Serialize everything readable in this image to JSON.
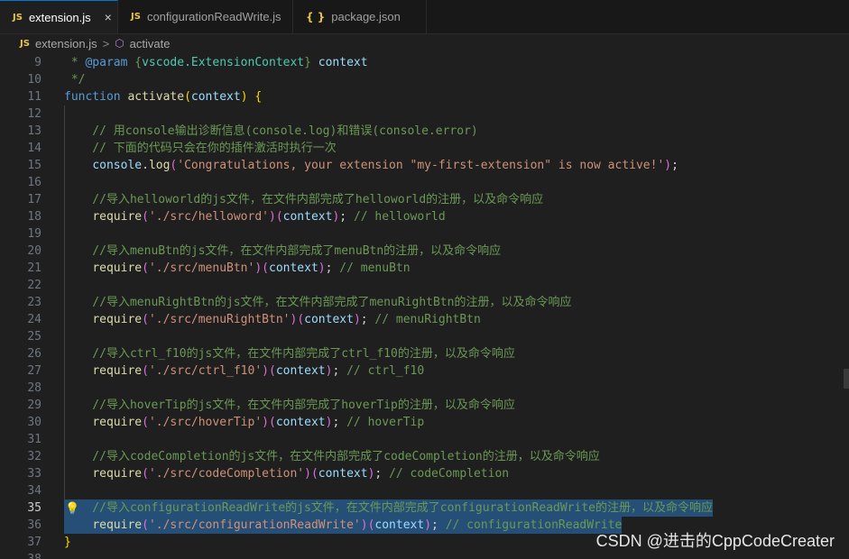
{
  "tabs": [
    {
      "icon": "JS",
      "label": "extension.js",
      "close": "×",
      "active": true
    },
    {
      "icon": "JS",
      "label": "configurationReadWrite.js",
      "active": false
    },
    {
      "icon": "{ }",
      "label": "package.json",
      "active": false
    }
  ],
  "breadcrumb": {
    "icon": "JS",
    "file": "extension.js",
    "separator": ">",
    "symbol_icon": "cube-icon",
    "symbol": "activate"
  },
  "lines": [
    {
      "n": "9",
      "parts": [
        [
          " * ",
          "c"
        ],
        [
          "@param",
          "dc"
        ],
        [
          " {",
          "c"
        ],
        [
          "vscode.ExtensionContext",
          "t"
        ],
        [
          "} ",
          "c"
        ],
        [
          "context",
          "p"
        ]
      ]
    },
    {
      "n": "10",
      "parts": [
        [
          " */",
          "c"
        ]
      ]
    },
    {
      "n": "11",
      "parts": [
        [
          "function",
          "k"
        ],
        [
          " ",
          "pl"
        ],
        [
          "activate",
          "f"
        ],
        [
          "(",
          "b1"
        ],
        [
          "context",
          "p"
        ],
        [
          ") ",
          "b1"
        ],
        [
          "{",
          "b1"
        ]
      ]
    },
    {
      "n": "12",
      "parts": []
    },
    {
      "n": "13",
      "parts": [
        [
          "    // 用console输出诊断信息(console.log)和错误(console.error)",
          "c"
        ]
      ]
    },
    {
      "n": "14",
      "parts": [
        [
          "    // 下面的代码只会在你的插件激活时执行一次",
          "c"
        ]
      ]
    },
    {
      "n": "15",
      "parts": [
        [
          "    ",
          "pl"
        ],
        [
          "console",
          "p"
        ],
        [
          ".",
          "pl"
        ],
        [
          "log",
          "f"
        ],
        [
          "(",
          "b2"
        ],
        [
          "'Congratulations, your extension \"my-first-extension\" is now active!'",
          "s"
        ],
        [
          ")",
          "b2"
        ],
        [
          ";",
          "pl"
        ]
      ]
    },
    {
      "n": "16",
      "parts": []
    },
    {
      "n": "17",
      "parts": [
        [
          "    //导入helloworld的js文件，在文件内部完成了helloworld的注册，以及命令响应",
          "c"
        ]
      ]
    },
    {
      "n": "18",
      "parts": [
        [
          "    ",
          "pl"
        ],
        [
          "require",
          "f"
        ],
        [
          "(",
          "b2"
        ],
        [
          "'./src/helloword'",
          "s"
        ],
        [
          ")",
          "b2"
        ],
        [
          "(",
          "b2"
        ],
        [
          "context",
          "p"
        ],
        [
          ")",
          "b2"
        ],
        [
          "; ",
          "pl"
        ],
        [
          "// helloworld",
          "c"
        ]
      ]
    },
    {
      "n": "19",
      "parts": []
    },
    {
      "n": "20",
      "parts": [
        [
          "    //导入menuBtn的js文件，在文件内部完成了menuBtn的注册，以及命令响应",
          "c"
        ]
      ]
    },
    {
      "n": "21",
      "parts": [
        [
          "    ",
          "pl"
        ],
        [
          "require",
          "f"
        ],
        [
          "(",
          "b2"
        ],
        [
          "'./src/menuBtn'",
          "s"
        ],
        [
          ")",
          "b2"
        ],
        [
          "(",
          "b2"
        ],
        [
          "context",
          "p"
        ],
        [
          ")",
          "b2"
        ],
        [
          "; ",
          "pl"
        ],
        [
          "// menuBtn",
          "c"
        ]
      ]
    },
    {
      "n": "22",
      "parts": []
    },
    {
      "n": "23",
      "parts": [
        [
          "    //导入menuRightBtn的js文件，在文件内部完成了menuRightBtn的注册，以及命令响应",
          "c"
        ]
      ]
    },
    {
      "n": "24",
      "parts": [
        [
          "    ",
          "pl"
        ],
        [
          "require",
          "f"
        ],
        [
          "(",
          "b2"
        ],
        [
          "'./src/menuRightBtn'",
          "s"
        ],
        [
          ")",
          "b2"
        ],
        [
          "(",
          "b2"
        ],
        [
          "context",
          "p"
        ],
        [
          ")",
          "b2"
        ],
        [
          "; ",
          "pl"
        ],
        [
          "// menuRightBtn",
          "c"
        ]
      ]
    },
    {
      "n": "25",
      "parts": []
    },
    {
      "n": "26",
      "parts": [
        [
          "    //导入ctrl_f10的js文件，在文件内部完成了ctrl_f10的注册，以及命令响应",
          "c"
        ]
      ]
    },
    {
      "n": "27",
      "parts": [
        [
          "    ",
          "pl"
        ],
        [
          "require",
          "f"
        ],
        [
          "(",
          "b2"
        ],
        [
          "'./src/ctrl_f10'",
          "s"
        ],
        [
          ")",
          "b2"
        ],
        [
          "(",
          "b2"
        ],
        [
          "context",
          "p"
        ],
        [
          ")",
          "b2"
        ],
        [
          "; ",
          "pl"
        ],
        [
          "// ctrl_f10",
          "c"
        ]
      ]
    },
    {
      "n": "28",
      "parts": []
    },
    {
      "n": "29",
      "parts": [
        [
          "    //导入hoverTip的js文件，在文件内部完成了hoverTip的注册，以及命令响应",
          "c"
        ]
      ]
    },
    {
      "n": "30",
      "parts": [
        [
          "    ",
          "pl"
        ],
        [
          "require",
          "f"
        ],
        [
          "(",
          "b2"
        ],
        [
          "'./src/hoverTip'",
          "s"
        ],
        [
          ")",
          "b2"
        ],
        [
          "(",
          "b2"
        ],
        [
          "context",
          "p"
        ],
        [
          ")",
          "b2"
        ],
        [
          "; ",
          "pl"
        ],
        [
          "// hoverTip",
          "c"
        ]
      ]
    },
    {
      "n": "31",
      "parts": []
    },
    {
      "n": "32",
      "parts": [
        [
          "    //导入codeCompletion的js文件，在文件内部完成了codeCompletion的注册，以及命令响应",
          "c"
        ]
      ]
    },
    {
      "n": "33",
      "parts": [
        [
          "    ",
          "pl"
        ],
        [
          "require",
          "f"
        ],
        [
          "(",
          "b2"
        ],
        [
          "'./src/codeCompletion'",
          "s"
        ],
        [
          ")",
          "b2"
        ],
        [
          "(",
          "b2"
        ],
        [
          "context",
          "p"
        ],
        [
          ")",
          "b2"
        ],
        [
          "; ",
          "pl"
        ],
        [
          "// codeCompletion",
          "c"
        ]
      ]
    },
    {
      "n": "34",
      "parts": []
    },
    {
      "n": "35",
      "current": true,
      "bulb": true,
      "sel": true,
      "parts": [
        [
          "    //导入configurationReadWrite的js文件，在文件内部完成了configurationReadWrite的注册，以及命令响应",
          "c"
        ]
      ]
    },
    {
      "n": "36",
      "sel": true,
      "parts": [
        [
          "    ",
          "pl"
        ],
        [
          "require",
          "f"
        ],
        [
          "(",
          "b2"
        ],
        [
          "'./src/configurationReadWrite'",
          "s"
        ],
        [
          ")",
          "b2"
        ],
        [
          "(",
          "b2"
        ],
        [
          "context",
          "p"
        ],
        [
          ")",
          "b2"
        ],
        [
          "; ",
          "pl"
        ],
        [
          "// configurationReadWrite",
          "c"
        ]
      ]
    },
    {
      "n": "37",
      "parts": [
        [
          "}",
          "b1"
        ]
      ]
    },
    {
      "n": "38",
      "parts": []
    }
  ],
  "watermark": "CSDN @进击的CppCodeCreater",
  "colors": {
    "background": "#1f1f1f",
    "selection": "#264f78",
    "accent": "#0078d4"
  }
}
